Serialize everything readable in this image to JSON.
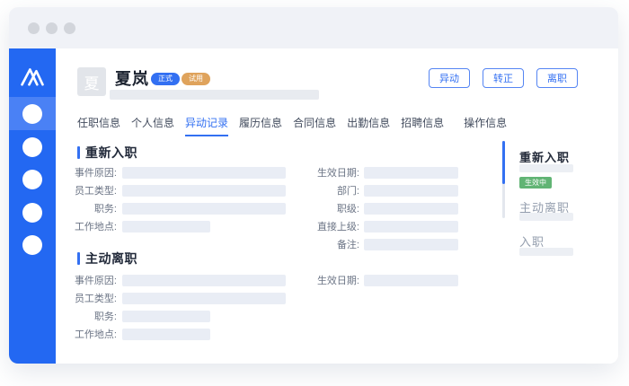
{
  "colors": {
    "accent": "#3370F2",
    "sidebar": "#2368F2",
    "sidebar_active_item": "#4A81F5",
    "badge_regular": "#3370F2",
    "badge_probation": "#DFA35C",
    "badge_status_green": "#61B474",
    "placeholder_bar": "#E9EDF5",
    "titlebar": "#F0F2F7"
  },
  "header": {
    "avatar_initial": "夏",
    "employee_name": "夏岚",
    "badges": [
      {
        "label": "正式"
      },
      {
        "label": "试用"
      }
    ],
    "action_buttons": [
      {
        "label": "异动"
      },
      {
        "label": "转正"
      },
      {
        "label": "离职"
      }
    ]
  },
  "tabs": [
    {
      "label": "任职信息",
      "active": false
    },
    {
      "label": "个人信息",
      "active": false
    },
    {
      "label": "异动记录",
      "active": true
    },
    {
      "label": "履历信息",
      "active": false
    },
    {
      "label": "合同信息",
      "active": false
    },
    {
      "label": "出勤信息",
      "active": false
    },
    {
      "label": "招聘信息",
      "active": false
    },
    {
      "label": "操作信息",
      "active": false
    }
  ],
  "sections": [
    {
      "title": "重新入职",
      "left_fields": [
        {
          "label": "事件原因:"
        },
        {
          "label": "员工类型:"
        },
        {
          "label": "职务:"
        },
        {
          "label": "工作地点:"
        }
      ],
      "right_fields": [
        {
          "label": "生效日期:"
        },
        {
          "label": "部门:"
        },
        {
          "label": "职级:"
        },
        {
          "label": "直接上级:"
        },
        {
          "label": "备注:"
        }
      ]
    },
    {
      "title": "主动离职",
      "left_fields": [
        {
          "label": "事件原因:"
        },
        {
          "label": "员工类型:"
        },
        {
          "label": "职务:"
        },
        {
          "label": "工作地点:"
        }
      ],
      "right_fields": [
        {
          "label": "生效日期:"
        }
      ]
    }
  ],
  "timeline": [
    {
      "title": "重新入职",
      "status_badge": "生效中",
      "active": true
    },
    {
      "title": "主动离职",
      "active": false
    },
    {
      "title": "入职",
      "active": false
    }
  ]
}
